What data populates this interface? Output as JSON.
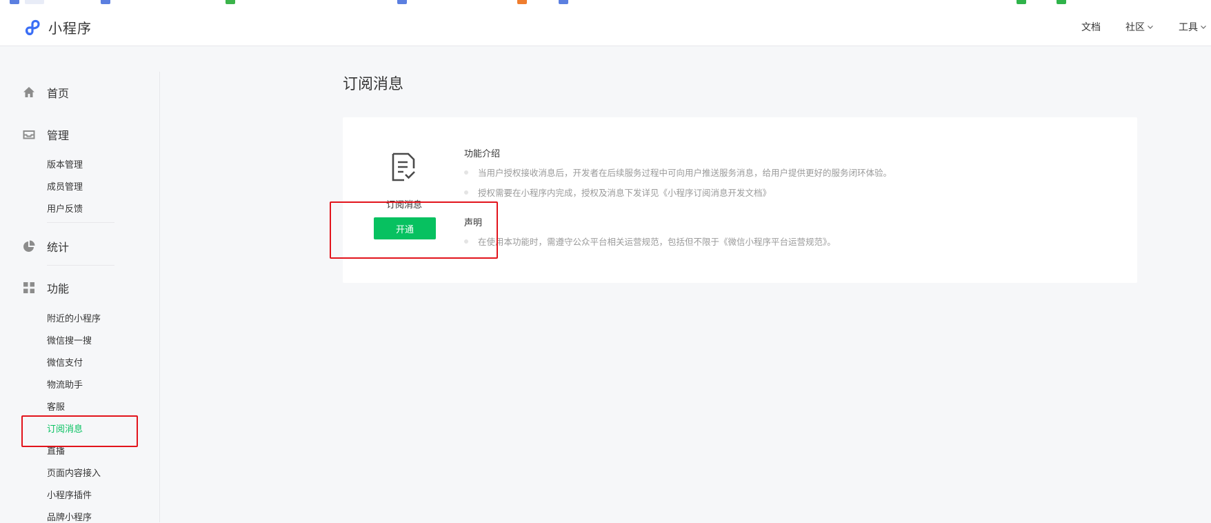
{
  "brand": {
    "name": "小程序",
    "color": "#07c160",
    "logo_color": "#3a6ef5"
  },
  "topnav": {
    "docs": "文档",
    "community": "社区",
    "tools": "工具"
  },
  "sidebar": {
    "home": "首页",
    "manage": {
      "label": "管理",
      "items": [
        "版本管理",
        "成员管理",
        "用户反馈"
      ]
    },
    "stats": "统计",
    "features": {
      "label": "功能",
      "items": [
        "附近的小程序",
        "微信搜一搜",
        "微信支付",
        "物流助手",
        "客服",
        "订阅消息",
        "直播",
        "页面内容接入",
        "小程序插件",
        "品牌小程序"
      ],
      "active": "订阅消息"
    }
  },
  "main": {
    "title": "订阅消息",
    "card": {
      "feature_name": "订阅消息",
      "open_button": "开通",
      "intro_title": "功能介绍",
      "intro_items": [
        "当用户授权接收消息后，开发者在后续服务过程中可向用户推送服务消息，给用户提供更好的服务闭环体验。",
        "授权需要在小程序内完成，授权及消息下发详见《小程序订阅消息开发文档》"
      ],
      "statement_title": "声明",
      "statement_items": [
        "在使用本功能时，需遵守公众平台相关运营规范，包括但不限于《微信小程序平台运营规范》。"
      ]
    }
  },
  "annotations": {
    "highlight_color": "#e2131b"
  }
}
